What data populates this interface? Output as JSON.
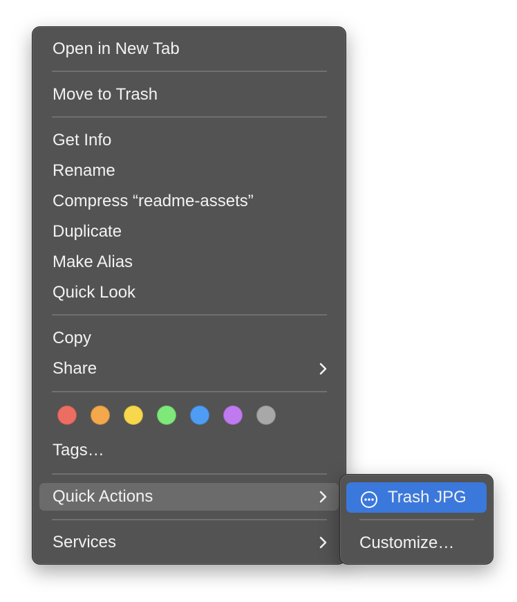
{
  "context_menu": {
    "items": [
      {
        "label": "Open in New Tab"
      },
      {
        "label": "Move to Trash"
      },
      {
        "label": "Get Info"
      },
      {
        "label": "Rename"
      },
      {
        "label": "Compress “readme-assets”"
      },
      {
        "label": "Duplicate"
      },
      {
        "label": "Make Alias"
      },
      {
        "label": "Quick Look"
      },
      {
        "label": "Copy"
      },
      {
        "label": "Share"
      },
      {
        "label": "Tags…"
      },
      {
        "label": "Quick Actions"
      },
      {
        "label": "Services"
      }
    ],
    "tag_colors": [
      {
        "name": "red",
        "color": "#ec6d62"
      },
      {
        "name": "orange",
        "color": "#f2a84b"
      },
      {
        "name": "yellow",
        "color": "#f7d84c"
      },
      {
        "name": "green",
        "color": "#7ee87a"
      },
      {
        "name": "blue",
        "color": "#4f9cf5"
      },
      {
        "name": "purple",
        "color": "#c07af0"
      },
      {
        "name": "gray",
        "color": "#a8a8a8"
      }
    ],
    "highlight_color": "#6b6b6b"
  },
  "quick_actions_submenu": {
    "items": [
      {
        "label": "Trash JPG",
        "icon": "ellipsis-circle-icon"
      },
      {
        "label": "Customize…"
      }
    ],
    "selected_color": "#3b78dc"
  }
}
